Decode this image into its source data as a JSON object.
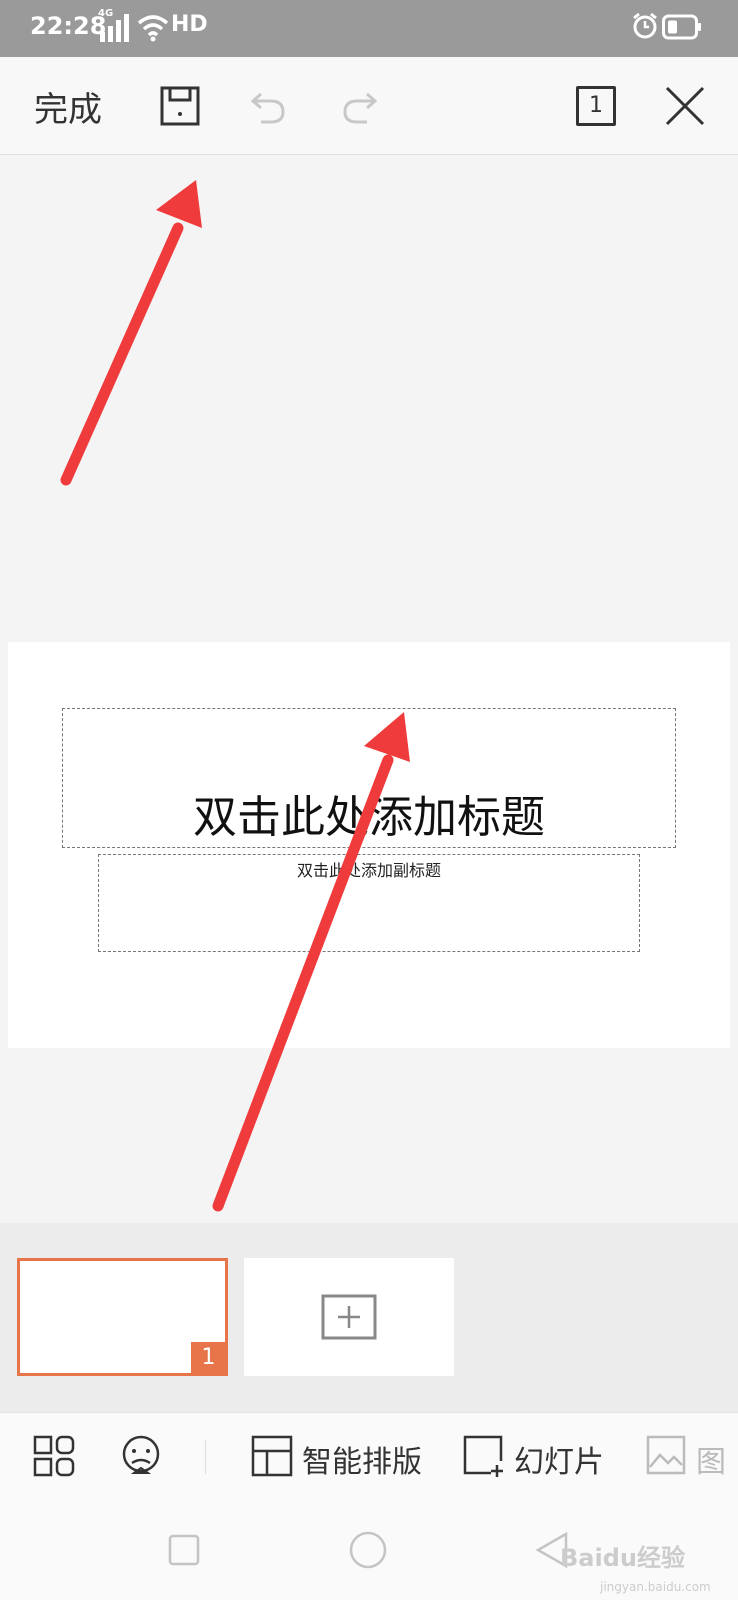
{
  "status_bar": {
    "time": "22:28",
    "network": "4G",
    "hd": "HD"
  },
  "toolbar": {
    "done_label": "完成",
    "icons": [
      "save-icon",
      "undo-icon",
      "redo-icon",
      "page-count-icon",
      "close-icon"
    ],
    "page_count": "1"
  },
  "slide": {
    "title_placeholder": "双击此处添加标题",
    "subtitle_placeholder": "双击此处添加副标题"
  },
  "thumbnails": {
    "current_number": "1"
  },
  "bottom_toolbar": {
    "smart_layout_label": "智能排版",
    "slide_label": "幻灯片",
    "picture_label": "图"
  },
  "watermark": {
    "text": "Baidu经验",
    "sub": "jingyan.baidu.com"
  },
  "colors": {
    "accent": "#e8744a",
    "annotation_arrow": "#ef3b3b",
    "status_bar": "#9a9a9a"
  }
}
